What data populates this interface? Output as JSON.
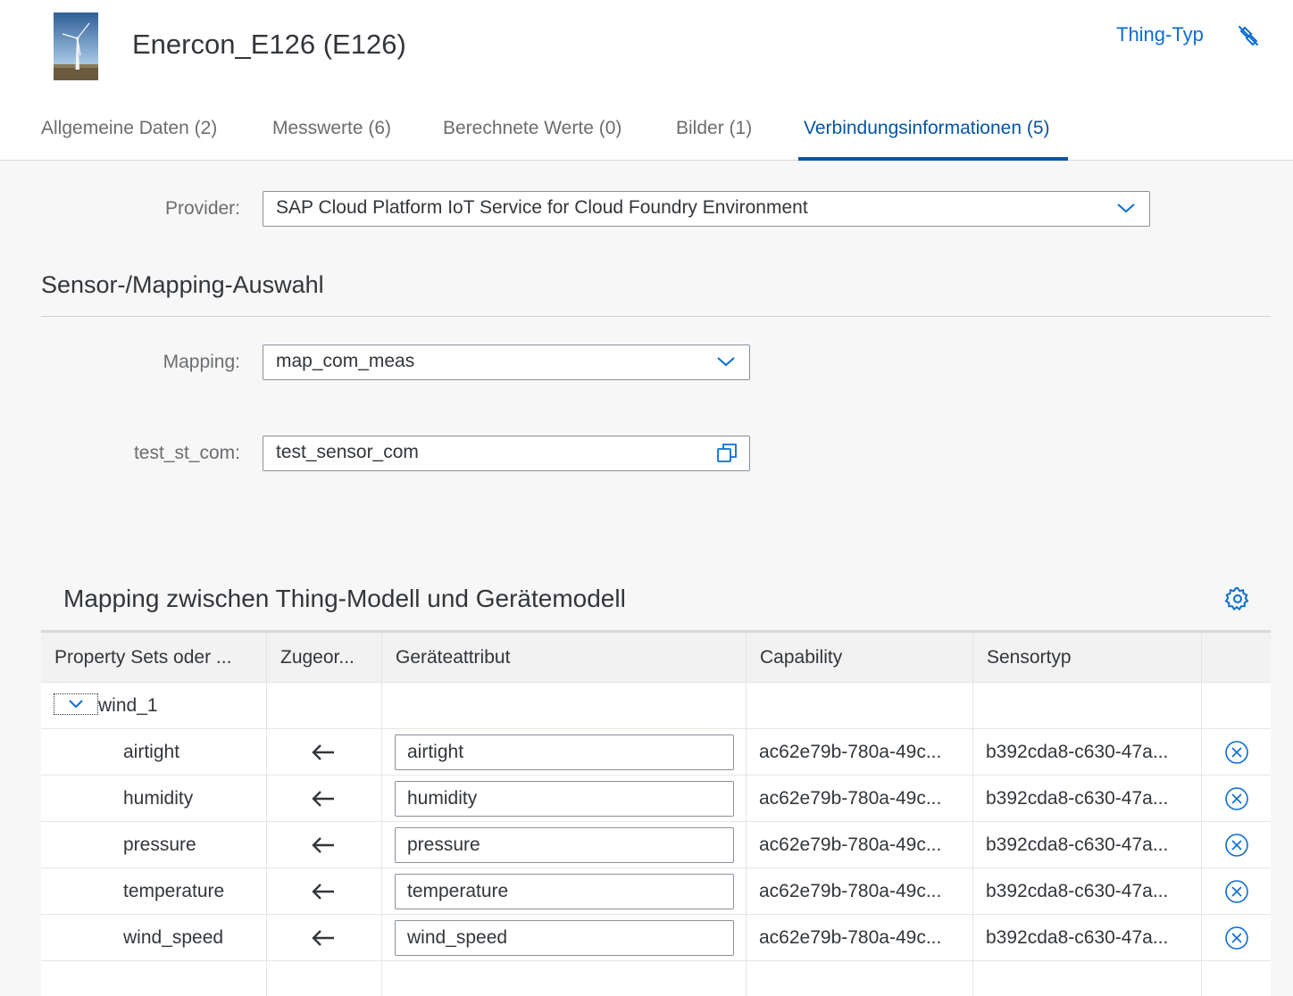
{
  "header": {
    "title": "Enercon_E126 (E126)",
    "thing_type_link": "Thing-Typ",
    "thumbnail_icon": "wind-turbine-image",
    "unlink_icon": "disconnect-icon"
  },
  "tabs": [
    {
      "label": "Allgemeine Daten (2)"
    },
    {
      "label": "Messwerte (6)"
    },
    {
      "label": "Berechnete Werte (0)"
    },
    {
      "label": "Bilder (1)"
    },
    {
      "label": "Verbindungsinformationen (5)",
      "selected": true
    }
  ],
  "provider": {
    "label": "Provider:",
    "value": "SAP Cloud Platform IoT Service for Cloud Foundry Environment"
  },
  "sensor_section": {
    "title": "Sensor-/Mapping-Auswahl",
    "mapping_label": "Mapping:",
    "mapping_value": "map_com_meas",
    "sensor_label": "test_st_com:",
    "sensor_value": "test_sensor_com"
  },
  "mapping_table": {
    "title": "Mapping zwischen Thing-Modell und Gerätemodell",
    "columns": [
      "Property Sets oder ...",
      "Zugeor...",
      "Geräteattribut",
      "Capability",
      "Sensortyp"
    ],
    "group": {
      "label": "wind_1",
      "expanded": true
    },
    "rows": [
      {
        "property": "airtight",
        "attribute": "airtight",
        "capability": "ac62e79b-780a-49c...",
        "sensortype": "b392cda8-c630-47a..."
      },
      {
        "property": "humidity",
        "attribute": "humidity",
        "capability": "ac62e79b-780a-49c...",
        "sensortype": "b392cda8-c630-47a..."
      },
      {
        "property": "pressure",
        "attribute": "pressure",
        "capability": "ac62e79b-780a-49c...",
        "sensortype": "b392cda8-c630-47a..."
      },
      {
        "property": "temperature",
        "attribute": "temperature",
        "capability": "ac62e79b-780a-49c...",
        "sensortype": "b392cda8-c630-47a..."
      },
      {
        "property": "wind_speed",
        "attribute": "wind_speed",
        "capability": "ac62e79b-780a-49c...",
        "sensortype": "b392cda8-c630-47a..."
      }
    ]
  },
  "colors": {
    "accent": "#0854a0",
    "link": "#0a6ed1",
    "background": "#f7f7f7"
  }
}
